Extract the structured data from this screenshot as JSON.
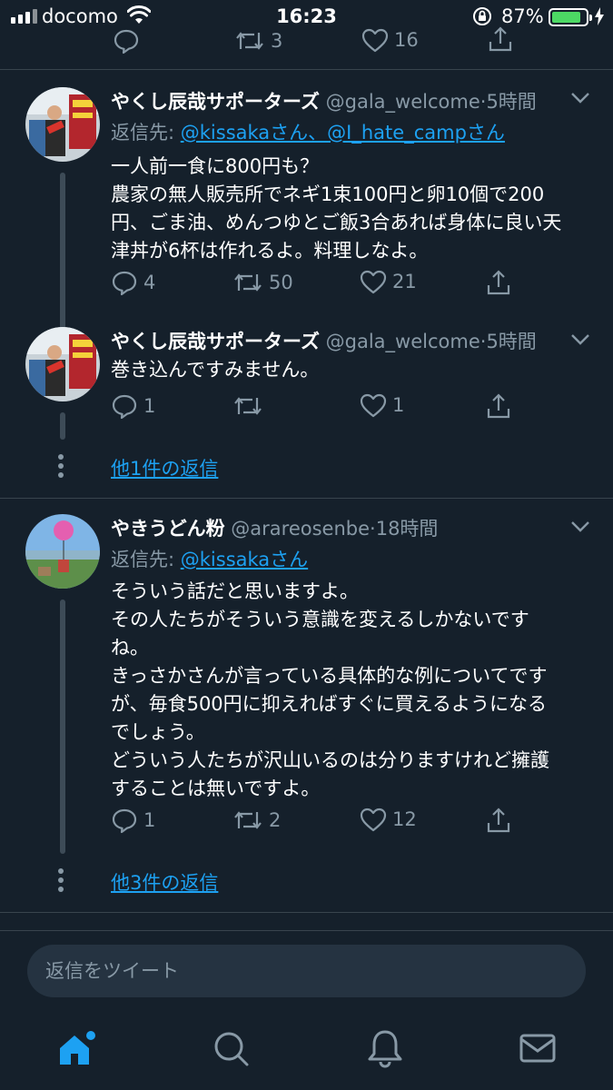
{
  "status_bar": {
    "carrier": "docomo",
    "time": "16:23",
    "battery_percent": "87%",
    "battery_level": 0.87
  },
  "top_actions": {
    "retweets": "3",
    "likes": "16"
  },
  "tweets": [
    {
      "name": "やくし辰哉サポーターズ",
      "handle": "@gala_welcome",
      "dot": "·",
      "age": "5時間",
      "replying_prefix": "返信先: ",
      "replying_mentions": "@kissakaさん、@I_hate_campさん",
      "lines": [
        "一人前一食に800円も？",
        "農家の無人販売所でネギ1束100円と卵10個で200",
        "円、ごま油、めんつゆとご飯3合あれば身体に良い天",
        "津丼が6杯は作れるよ。料理しなよ。"
      ],
      "replies": "4",
      "retweets": "50",
      "likes": "21"
    },
    {
      "name": "やくし辰哉サポーターズ",
      "handle": "@gala_welcome",
      "dot": "·",
      "age": "5時間",
      "lines": [
        "巻き込んですみません。"
      ],
      "replies": "1",
      "retweets": "",
      "likes": "1",
      "more_replies": "他1件の返信"
    },
    {
      "name": "やきうどん粉",
      "handle": "@arareosenbe",
      "dot": "·",
      "age": "18時間",
      "replying_prefix": "返信先: ",
      "replying_mentions": "@kissakaさん",
      "lines": [
        "そういう話だと思いますよ。",
        "その人たちがそういう意識を変えるしかないです",
        "ね。",
        "きっさかさんが言っている具体的な例についてです",
        "が、毎食500円に抑えればすぐに買えるようになる",
        "でしょう。",
        "どういう人たちが沢山いるのは分りますけれど擁護",
        "することは無いですよ。"
      ],
      "replies": "1",
      "retweets": "2",
      "likes": "12",
      "more_replies": "他3件の返信"
    }
  ],
  "composer": {
    "placeholder": "返信をツイート"
  },
  "tabbar": {
    "items": [
      "home-icon",
      "search-icon",
      "notifications-icon",
      "messages-icon"
    ],
    "accent": "#1da1f2"
  },
  "colors": {
    "background": "#15202b",
    "muted": "#8899a6",
    "link": "#1da1f2",
    "battery": "#4cd964"
  }
}
